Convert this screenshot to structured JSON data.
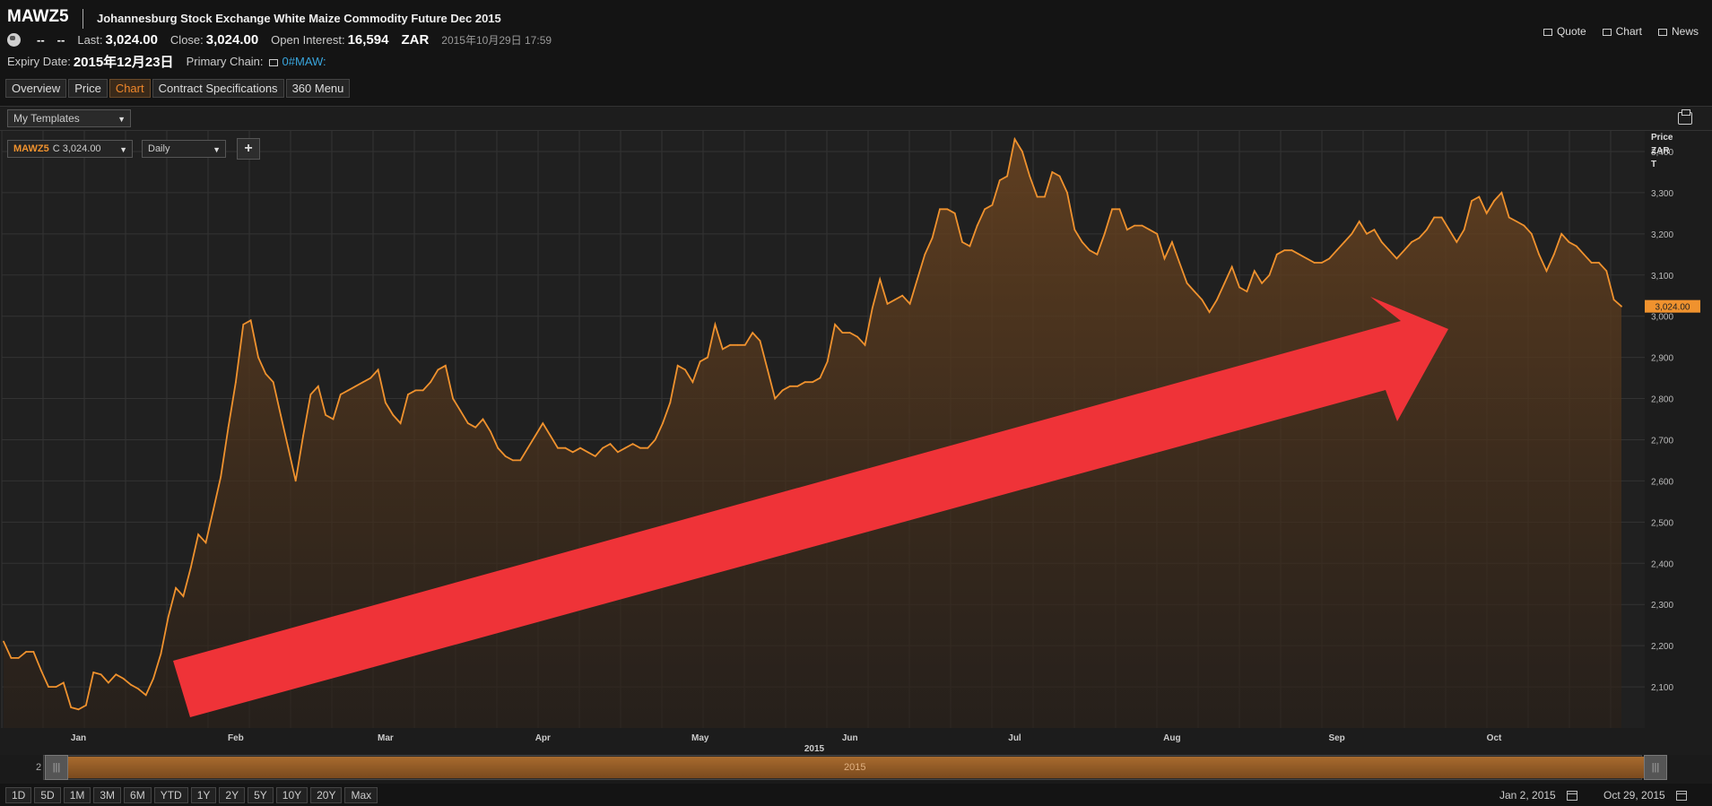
{
  "header": {
    "ric": "MAWZ5",
    "title": "Johannesburg Stock Exchange White Maize Commodity Future Dec 2015",
    "dash1": "--",
    "dash2": "--",
    "last_label": "Last:",
    "last_value": "3,024.00",
    "close_label": "Close:",
    "close_value": "3,024.00",
    "oi_label": "Open Interest:",
    "oi_value": "16,594",
    "currency": "ZAR",
    "timestamp": "2015年10月29日 17:59",
    "expiry_label": "Expiry Date:",
    "expiry_value": "2015年12月23日",
    "chain_label": "Primary Chain:",
    "chain_value": "0#MAW:"
  },
  "toplinks": {
    "quote": "Quote",
    "chart": "Chart",
    "news": "News"
  },
  "tabs": [
    {
      "label": "Overview",
      "active": false
    },
    {
      "label": "Price",
      "active": false
    },
    {
      "label": "Chart",
      "active": true
    },
    {
      "label": "Contract Specifications",
      "active": false
    },
    {
      "label": "360 Menu",
      "active": false
    }
  ],
  "toolbar": {
    "templates": "My Templates"
  },
  "chart_controls": {
    "series_ric": "MAWZ5",
    "series_value": "C 3,024.00",
    "interval": "Daily",
    "add": "+"
  },
  "navigator": {
    "year": "2015",
    "two": "2"
  },
  "range_buttons": [
    "1D",
    "5D",
    "1M",
    "3M",
    "6M",
    "YTD",
    "1Y",
    "2Y",
    "5Y",
    "10Y",
    "20Y",
    "Max"
  ],
  "date_range": {
    "start": "Jan 2, 2015",
    "end": "Oct 29, 2015"
  },
  "colors": {
    "line": "#f0922e",
    "arrow": "#ef3338",
    "active_tab": "#f0872a",
    "link": "#39a5dc"
  },
  "annotation": {
    "type": "arrow",
    "color": "#ef3338",
    "direction": "up-right"
  },
  "chart_data": {
    "type": "area",
    "axis_title": [
      "Price",
      "ZAR",
      "T"
    ],
    "y_ticks": [
      2100,
      2200,
      2300,
      2400,
      2500,
      2600,
      2700,
      2800,
      2900,
      3000,
      3100,
      3200,
      3300,
      3400
    ],
    "y_tick_labels": [
      "2,100",
      "2,200",
      "2,300",
      "2,400",
      "2,500",
      "2,600",
      "2,700",
      "2,800",
      "2,900",
      "3,000",
      "3,100",
      "3,200",
      "3,300",
      "3,400"
    ],
    "ylim": [
      2000,
      3450
    ],
    "x_months": [
      "Jan",
      "Feb",
      "Mar",
      "Apr",
      "May",
      "Jun",
      "Jul",
      "Aug",
      "Sep",
      "Oct"
    ],
    "x_year": "2015",
    "last_price_label": "3,024.00",
    "series": [
      {
        "name": "MAWZ5",
        "values": [
          2210,
          2170,
          2170,
          2185,
          2185,
          2140,
          2100,
          2100,
          2110,
          2050,
          2045,
          2055,
          2135,
          2130,
          2110,
          2130,
          2120,
          2105,
          2095,
          2080,
          2120,
          2180,
          2270,
          2340,
          2320,
          2390,
          2470,
          2450,
          2530,
          2610,
          2730,
          2840,
          2980,
          2990,
          2900,
          2860,
          2840,
          2760,
          2680,
          2600,
          2710,
          2810,
          2830,
          2760,
          2750,
          2810,
          2820,
          2830,
          2840,
          2850,
          2870,
          2790,
          2760,
          2740,
          2810,
          2820,
          2820,
          2840,
          2870,
          2880,
          2800,
          2770,
          2740,
          2730,
          2750,
          2720,
          2680,
          2660,
          2650,
          2650,
          2680,
          2710,
          2740,
          2710,
          2680,
          2680,
          2670,
          2680,
          2670,
          2660,
          2680,
          2690,
          2670,
          2680,
          2690,
          2680,
          2680,
          2700,
          2740,
          2790,
          2880,
          2870,
          2840,
          2890,
          2900,
          2980,
          2920,
          2930,
          2930,
          2930,
          2960,
          2940,
          2870,
          2800,
          2820,
          2830,
          2830,
          2840,
          2840,
          2850,
          2890,
          2980,
          2960,
          2960,
          2950,
          2930,
          3020,
          3090,
          3030,
          3040,
          3050,
          3030,
          3090,
          3150,
          3190,
          3260,
          3260,
          3250,
          3180,
          3170,
          3220,
          3260,
          3270,
          3330,
          3340,
          3430,
          3400,
          3340,
          3290,
          3290,
          3350,
          3340,
          3300,
          3210,
          3180,
          3160,
          3150,
          3200,
          3260,
          3260,
          3210,
          3220,
          3220,
          3210,
          3200,
          3140,
          3180,
          3130,
          3080,
          3060,
          3040,
          3010,
          3040,
          3080,
          3120,
          3070,
          3060,
          3110,
          3080,
          3100,
          3150,
          3160,
          3160,
          3150,
          3140,
          3130,
          3130,
          3140,
          3160,
          3180,
          3200,
          3230,
          3200,
          3210,
          3180,
          3160,
          3140,
          3160,
          3180,
          3190,
          3210,
          3240,
          3240,
          3210,
          3180,
          3210,
          3280,
          3290,
          3250,
          3280,
          3300,
          3240,
          3230,
          3220,
          3200,
          3150,
          3110,
          3150,
          3200,
          3180,
          3170,
          3150,
          3130,
          3130,
          3110,
          3040,
          3024
        ]
      }
    ]
  }
}
